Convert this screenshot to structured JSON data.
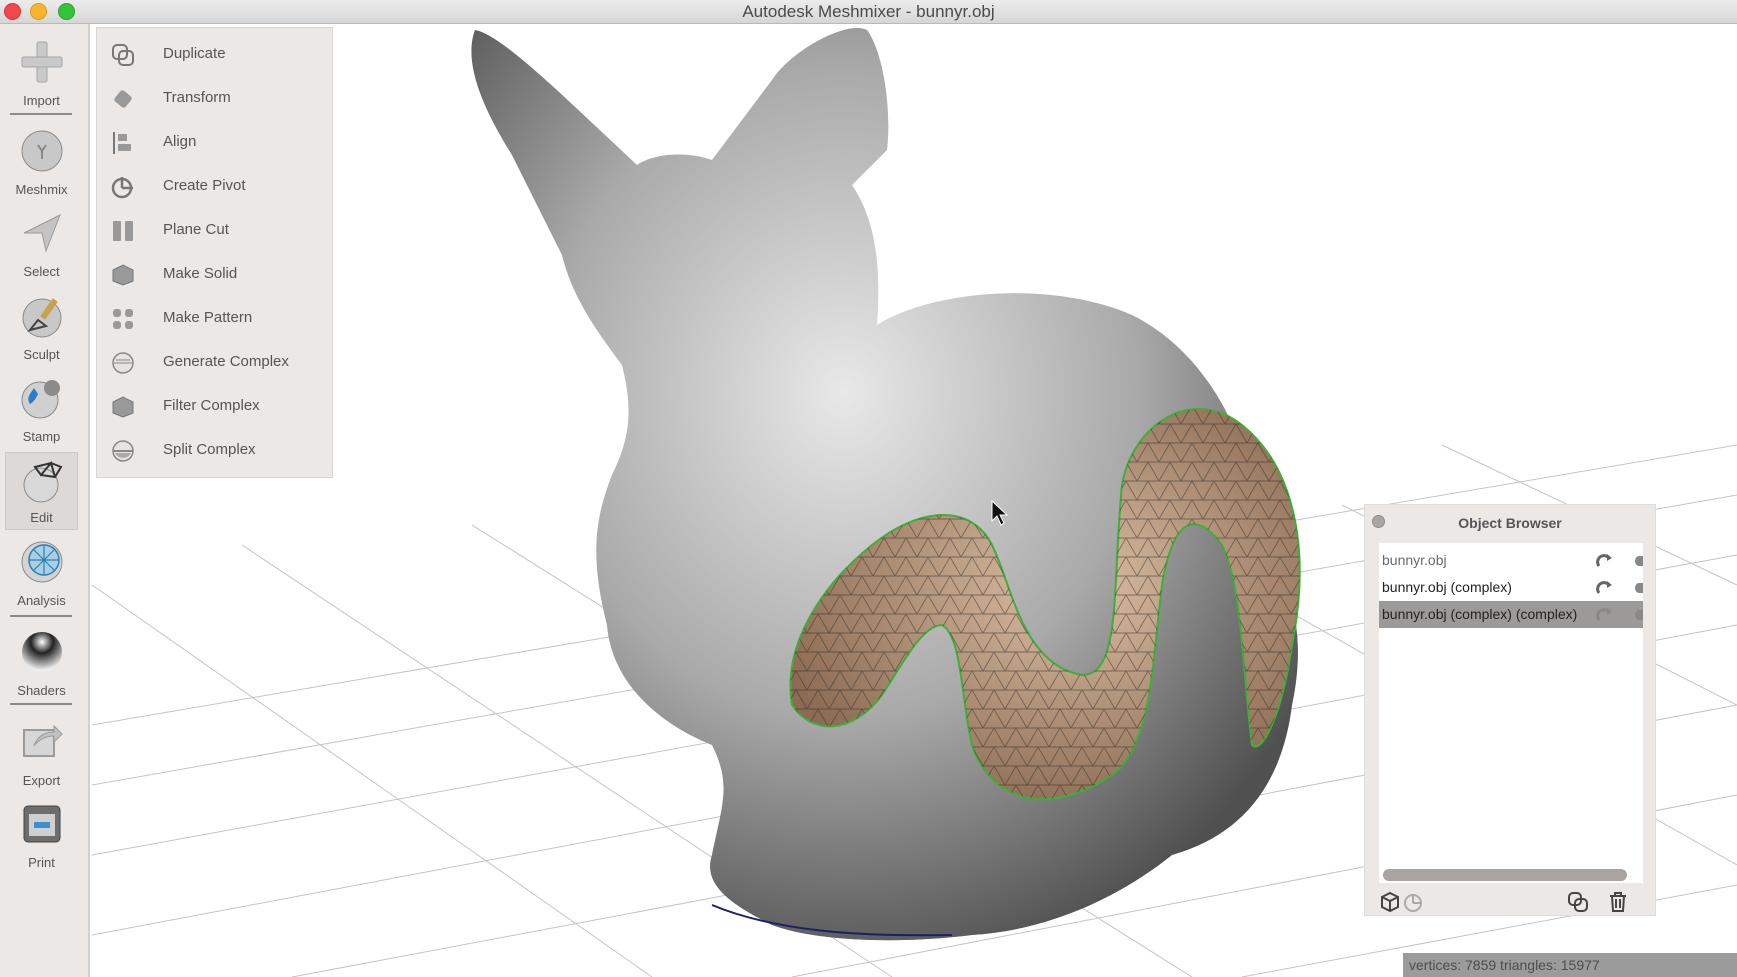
{
  "window": {
    "title": "Autodesk Meshmixer - bunnyr.obj"
  },
  "toolbar": {
    "items": [
      {
        "label": "Import",
        "icon": "plus-icon"
      },
      {
        "label": "Meshmix",
        "icon": "meshmix-sphere-icon"
      },
      {
        "label": "Select",
        "icon": "select-arrow-icon"
      },
      {
        "label": "Sculpt",
        "icon": "sculpt-brush-icon"
      },
      {
        "label": "Stamp",
        "icon": "stamp-icon"
      },
      {
        "label": "Edit",
        "icon": "edit-mesh-icon",
        "active": true
      },
      {
        "label": "Analysis",
        "icon": "analysis-icon"
      },
      {
        "label": "Shaders",
        "icon": "shader-sphere-icon"
      },
      {
        "label": "Export",
        "icon": "export-icon"
      },
      {
        "label": "Print",
        "icon": "printer-icon"
      }
    ]
  },
  "edit_menu": {
    "items": [
      {
        "label": "Duplicate",
        "icon": "duplicate-icon"
      },
      {
        "label": "Transform",
        "icon": "transform-icon"
      },
      {
        "label": "Align",
        "icon": "align-icon"
      },
      {
        "label": "Create Pivot",
        "icon": "pivot-icon"
      },
      {
        "label": "Plane Cut",
        "icon": "plane-cut-icon"
      },
      {
        "label": "Make Solid",
        "icon": "make-solid-icon"
      },
      {
        "label": "Make Pattern",
        "icon": "make-pattern-icon"
      },
      {
        "label": "Generate Complex",
        "icon": "generate-complex-icon"
      },
      {
        "label": "Filter Complex",
        "icon": "filter-complex-icon"
      },
      {
        "label": "Split Complex",
        "icon": "split-complex-icon"
      }
    ]
  },
  "object_browser": {
    "title": "Object Browser",
    "objects": [
      {
        "name": "bunnyr.obj",
        "selected": false,
        "dim": true
      },
      {
        "name": "bunnyr.obj (complex)",
        "selected": false,
        "dim": false
      },
      {
        "name": "bunnyr.obj (complex) (complex)",
        "selected": true,
        "dim": false
      }
    ],
    "footer_icons": [
      "cube-icon",
      "pivot-icon",
      "duplicate-icon",
      "trash-icon"
    ]
  },
  "status_bar": {
    "text": "vertices: 7859 triangles: 15977"
  },
  "colors": {
    "mesh": "#8c8c8c",
    "selection": "#b08f72",
    "selection_border": "#3fae3a",
    "panel": "#ebe8e6"
  }
}
